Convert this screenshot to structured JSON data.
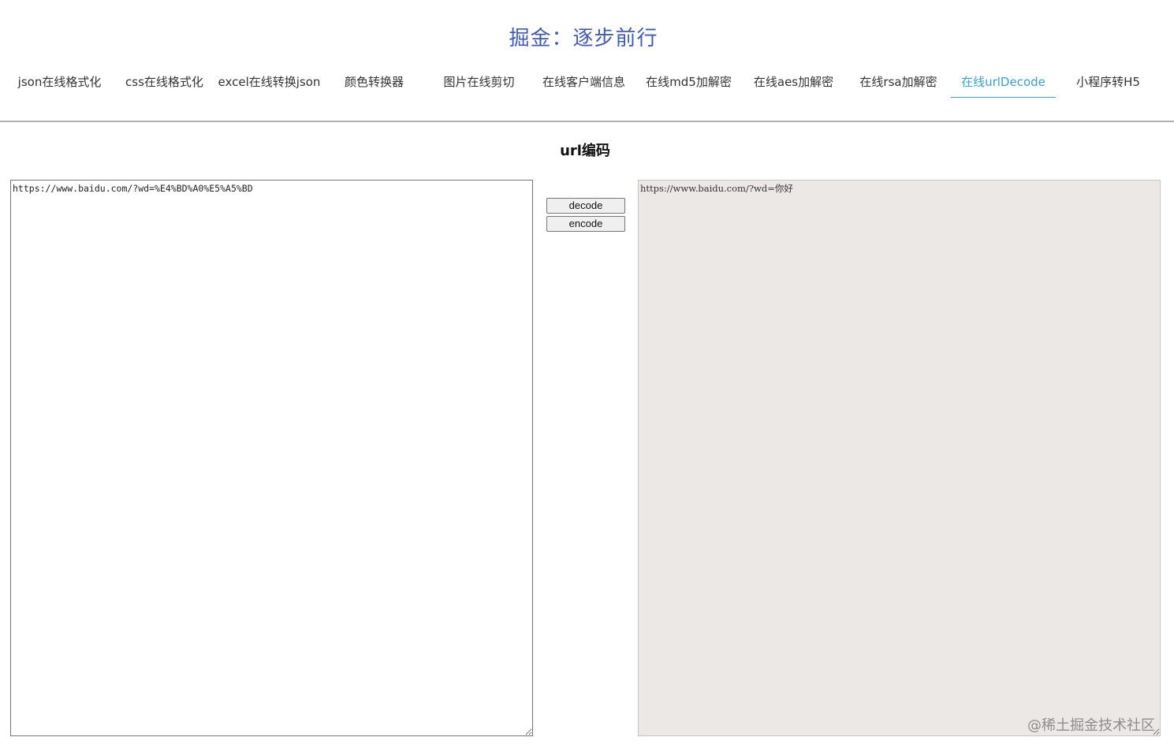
{
  "site_title": "掘金：逐步前行",
  "nav": {
    "items": [
      "json在线格式化",
      "css在线格式化",
      "excel在线转换json",
      "颜色转换器",
      "图片在线剪切",
      "在线客户端信息",
      "在线md5加解密",
      "在线aes加解密",
      "在线rsa加解密",
      "在线urlDecode",
      "小程序转H5"
    ],
    "active": "在线urlDecode"
  },
  "section_title": "url编码",
  "input_text": "https://www.baidu.com/?wd=%E4%BD%A0%E5%A5%BD",
  "output_text": "https://www.baidu.com/?wd=你好",
  "buttons": {
    "decode": "decode",
    "encode": "encode"
  },
  "watermark": "@稀土掘金技术社区",
  "colors": {
    "title": "#3f5bb4",
    "nav_active": "#3aa0d2",
    "output_bg": "#ebe8e6"
  }
}
